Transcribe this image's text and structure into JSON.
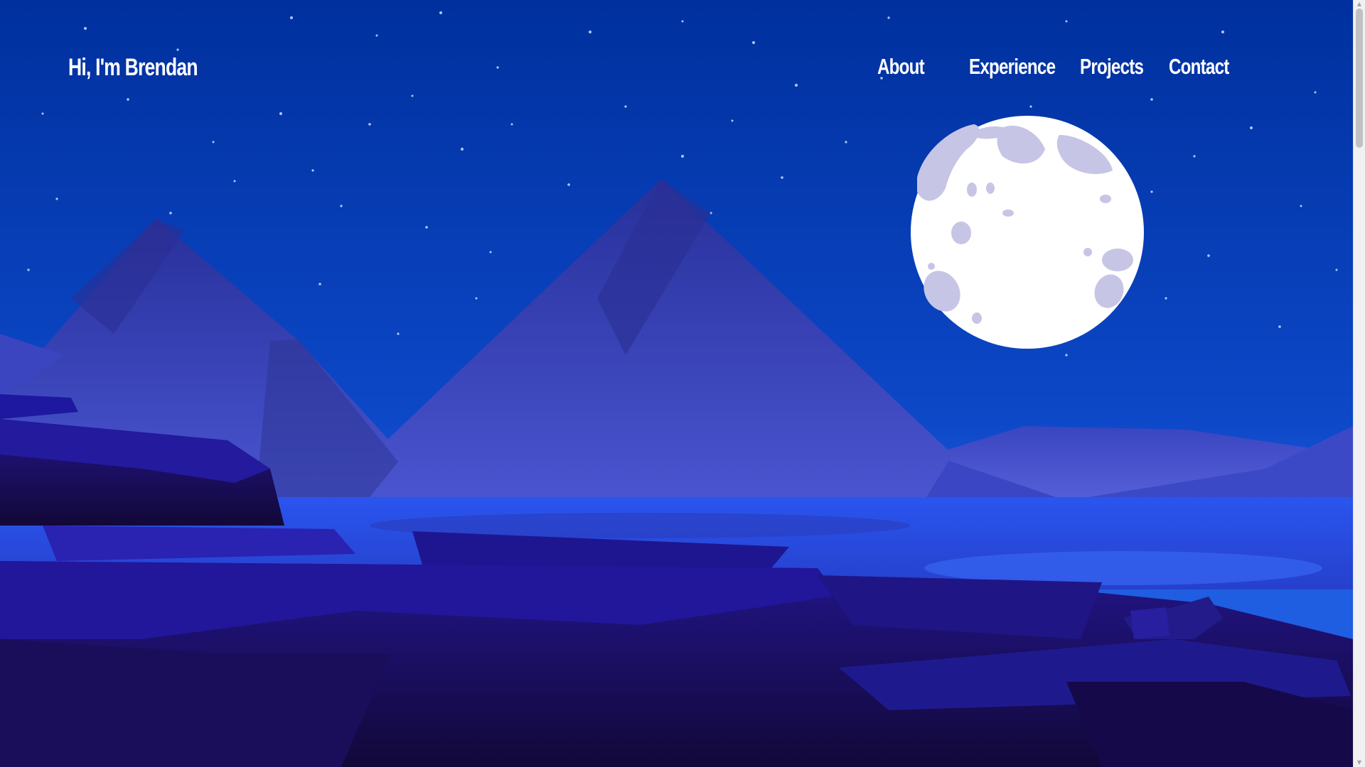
{
  "header": {
    "brand": "Hi, I'm Brendan",
    "nav": [
      {
        "label": "About"
      },
      {
        "label": "Experience"
      },
      {
        "label": "Projects"
      },
      {
        "label": "Contact"
      }
    ]
  },
  "scene": {
    "description_icons": [
      "moon-icon",
      "mountains",
      "stars",
      "lake",
      "cliffs"
    ],
    "colors": {
      "sky_top": "#00309e",
      "sky_bottom": "#1a55d8",
      "mountain": "#3340b8",
      "mountain_shadow": "#1f2a8f",
      "lake": "#2a4de0",
      "cliff_top": "#1f1a9a",
      "cliff_dark": "#170a45",
      "moon": "#ffffff",
      "moon_crater": "#c9c8e8"
    }
  },
  "scrollbar": {
    "up_icon": "chevron-up-icon",
    "down_icon": "chevron-down-icon"
  }
}
